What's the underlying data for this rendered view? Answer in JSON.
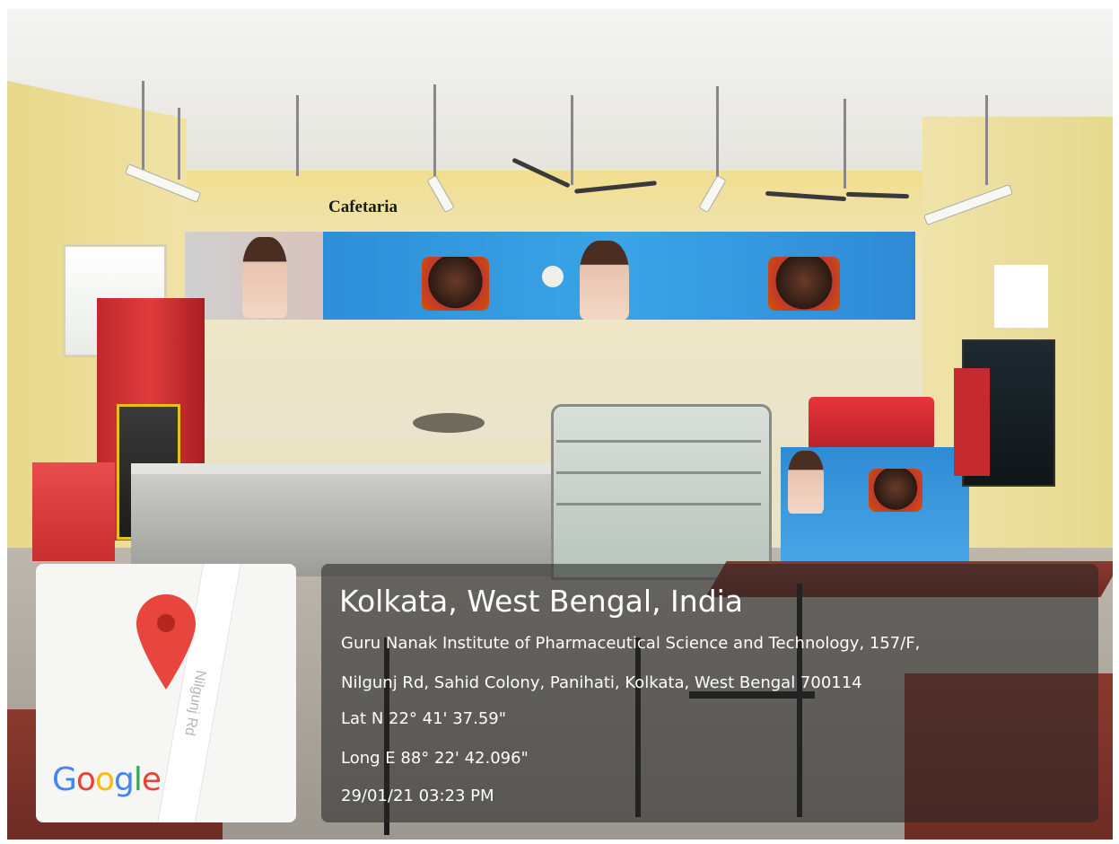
{
  "sign": {
    "text": "Cafetaria"
  },
  "location": {
    "title": "Kolkata, West Bengal, India",
    "address_line_1": "Guru Nanak Institute of Pharmaceutical Science and Technology, 157/F,",
    "address_line_2": "Nilgunj Rd, Sahid Colony, Panihati, Kolkata, West Bengal 700114",
    "latitude": "Lat N 22° 41' 37.59\"",
    "longitude": "Long E 88° 22' 42.096\"",
    "timestamp": "29/01/21 03:23 PM"
  },
  "map": {
    "road_label": "Nilgunj Rd",
    "logo": {
      "g1": "G",
      "o1": "o",
      "o2": "o",
      "g2": "g",
      "l": "l",
      "e": "e"
    },
    "pin_icon": "map-pin-icon",
    "colors": {
      "pin": "#e8453c",
      "blue": "#4285f4",
      "red": "#ea4335",
      "yellow": "#fbbc05",
      "green": "#34a853"
    }
  }
}
